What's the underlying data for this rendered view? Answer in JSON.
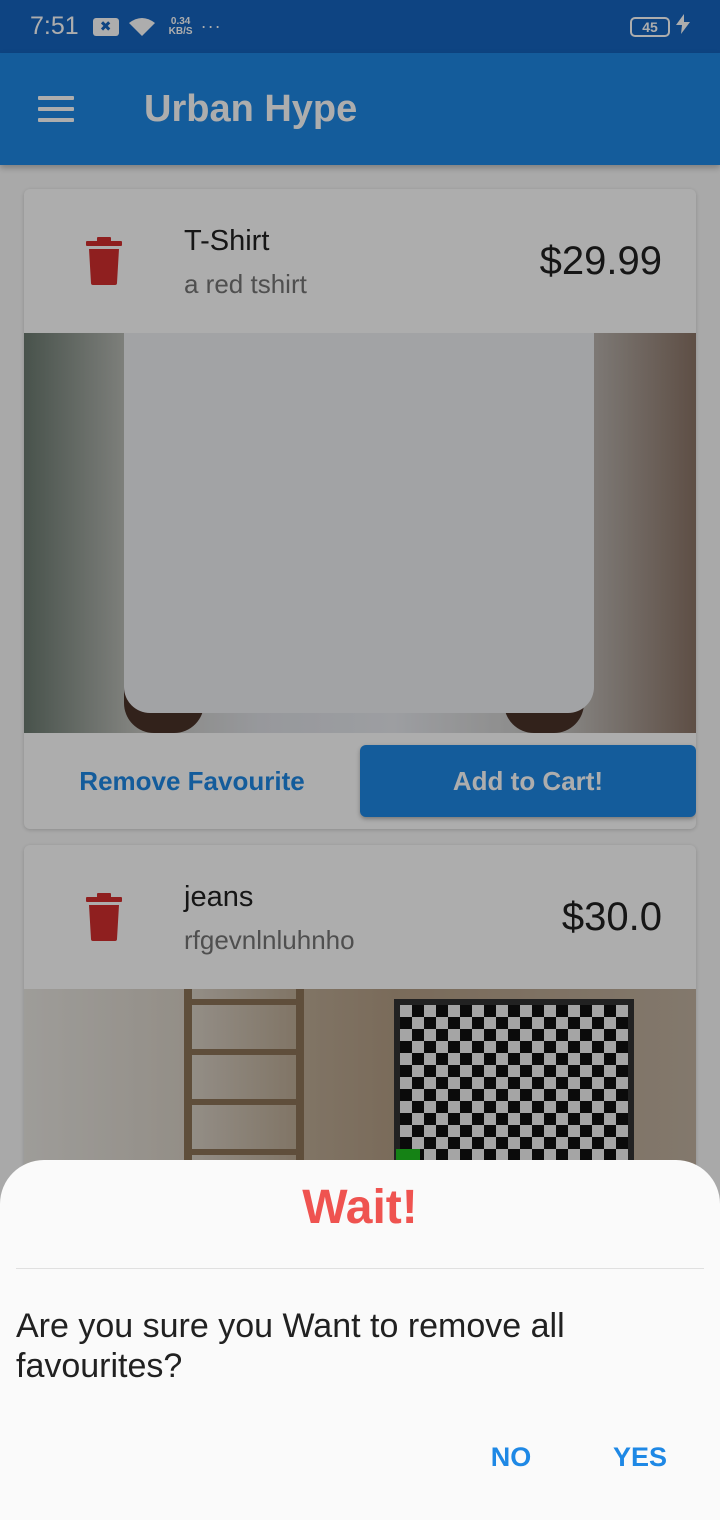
{
  "status_bar": {
    "time": "7:51",
    "network_speed_value": "0.34",
    "network_speed_unit": "KB/S",
    "more_indicator": "···",
    "battery_level": "45",
    "icons": [
      "notification-icon",
      "wifi-icon",
      "battery-icon",
      "charging-icon"
    ]
  },
  "app_bar": {
    "title": "Urban Hype",
    "menu_icon": "hamburger-menu-icon"
  },
  "favourites": [
    {
      "name": "T-Shirt",
      "description": "a red tshirt",
      "price": "$29.99",
      "remove_label": "Remove Favourite",
      "add_to_cart_label": "Add to Cart!"
    },
    {
      "name": "jeans",
      "description": "rfgevnlnluhnho",
      "price": "$30.0"
    }
  ],
  "colors": {
    "primary": "#1e88e5",
    "status_bar": "#1565c0",
    "delete_icon": "#d32f2f",
    "dialog_title": "#ef5350"
  },
  "dialog": {
    "title": "Wait!",
    "message": "Are you sure you Want to remove all favourites?",
    "no_label": "NO",
    "yes_label": "YES"
  }
}
